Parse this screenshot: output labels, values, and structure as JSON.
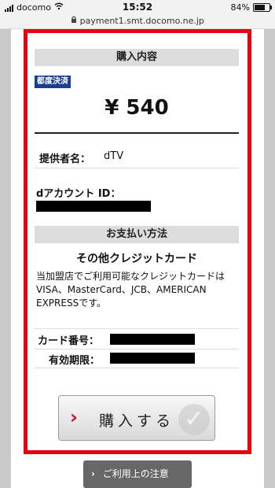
{
  "status_bar": {
    "carrier": "docomo",
    "time": "15:52",
    "battery": "84%",
    "battery_level": 0.84
  },
  "browser": {
    "url": "payment1.smt.docomo.ne.jp"
  },
  "purchase": {
    "header": "購入内容",
    "badge": "都度決済",
    "price": "¥ 540",
    "provider_label": "提供者名：",
    "provider_value": "dTV",
    "account_label": "dアカウント ID："
  },
  "payment_method": {
    "header": "お支払い方法",
    "title": "その他クレジットカード",
    "description": "当加盟店でご利用可能なクレジットカードはVISA、MasterCard、JCB、AMERICAN EXPRESSです。",
    "card_number_label": "カード番号：",
    "expiry_label": "有効期限："
  },
  "actions": {
    "buy_label": "購入する",
    "notice_label": "ご利用上の注意"
  },
  "colors": {
    "highlight_frame": "#e60012",
    "badge_bg": "#1a3e8f",
    "chevron": "#c8102e"
  },
  "icons": [
    "signal-icon",
    "wifi-icon",
    "lock-icon",
    "battery-icon",
    "chevron-right-icon",
    "check-icon"
  ]
}
